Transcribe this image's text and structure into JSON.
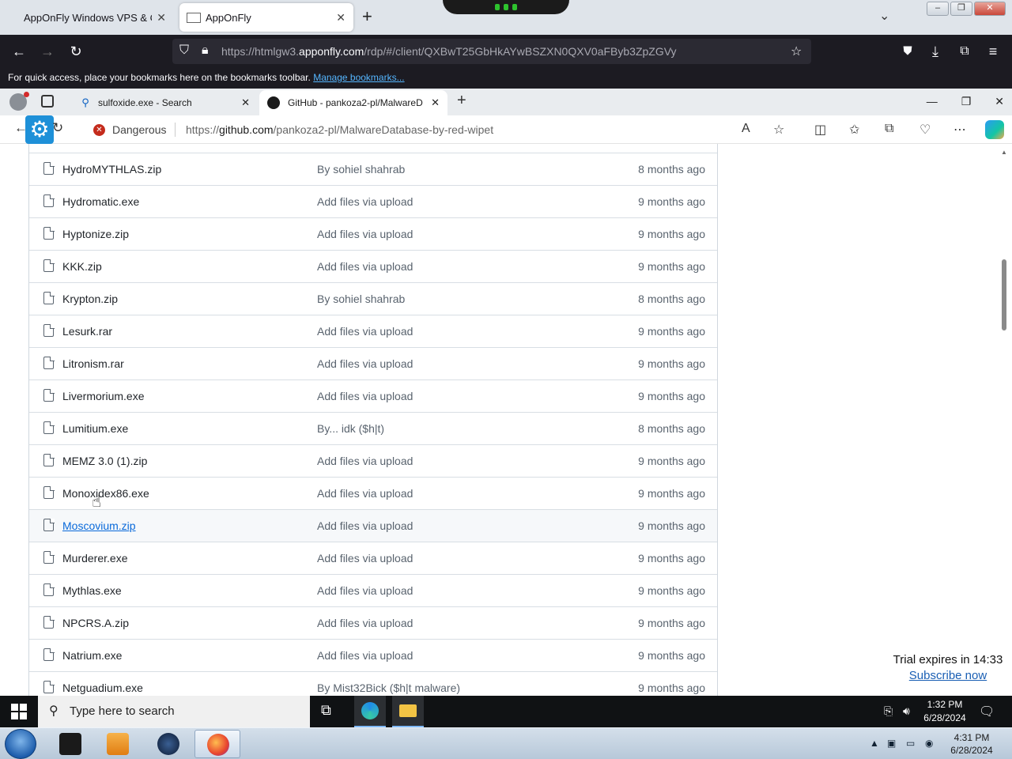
{
  "firefox": {
    "tabs": [
      {
        "label": "AppOnFly Windows VPS & Clo"
      },
      {
        "label": "AppOnFly"
      }
    ],
    "url_prefix": "https://htmlgw3.",
    "url_domain": "apponfly.com",
    "url_rest": "/rdp/#/client/QXBwT25GbHkAYwBSZXN0QXV0aFByb3ZpZGVy",
    "bookmarks_text": "For quick access, place your bookmarks here on the bookmarks toolbar.",
    "bookmarks_link": "Manage bookmarks..."
  },
  "edge": {
    "tabs": [
      {
        "label": "sulfoxide.exe - Search"
      },
      {
        "label": "GitHub - pankoza2-pl/MalwareD"
      }
    ],
    "security_label": "Dangerous",
    "url_prefix": "https://",
    "url_domain": "github.com",
    "url_rest": "/pankoza2-pl/MalwareDatabase-by-red-wipet"
  },
  "files": [
    {
      "name": "HydroMYTHLAS.zip",
      "message": "By sohiel shahrab",
      "age": "8 months ago"
    },
    {
      "name": "Hydromatic.exe",
      "message": "Add files via upload",
      "age": "9 months ago"
    },
    {
      "name": "Hyptonize.zip",
      "message": "Add files via upload",
      "age": "9 months ago"
    },
    {
      "name": "KKK.zip",
      "message": "Add files via upload",
      "age": "9 months ago"
    },
    {
      "name": "Krypton.zip",
      "message": "By sohiel shahrab",
      "age": "8 months ago"
    },
    {
      "name": "Lesurk.rar",
      "message": "Add files via upload",
      "age": "9 months ago"
    },
    {
      "name": "Litronism.rar",
      "message": "Add files via upload",
      "age": "9 months ago"
    },
    {
      "name": "Livermorium.exe",
      "message": "Add files via upload",
      "age": "9 months ago"
    },
    {
      "name": "Lumitium.exe",
      "message": "By... idk ($h|t)",
      "age": "8 months ago"
    },
    {
      "name": "MEMZ 3.0 (1).zip",
      "message": "Add files via upload",
      "age": "9 months ago"
    },
    {
      "name": "Monoxidex86.exe",
      "message": "Add files via upload",
      "age": "9 months ago"
    },
    {
      "name": "Moscovium.zip",
      "message": "Add files via upload",
      "age": "9 months ago"
    },
    {
      "name": "Murderer.exe",
      "message": "Add files via upload",
      "age": "9 months ago"
    },
    {
      "name": "Mythlas.exe",
      "message": "Add files via upload",
      "age": "9 months ago"
    },
    {
      "name": "NPCRS.A.zip",
      "message": "Add files via upload",
      "age": "9 months ago"
    },
    {
      "name": "Natrium.exe",
      "message": "Add files via upload",
      "age": "9 months ago"
    },
    {
      "name": "Netguadium.exe",
      "message": "By Mist32Bick ($h|t malware)",
      "age": "9 months ago"
    }
  ],
  "trial": {
    "text": "Trial expires in 14:33",
    "link": "Subscribe now"
  },
  "taskbar10": {
    "search_placeholder": "Type here to search",
    "time": "1:32 PM",
    "date": "6/28/2024"
  },
  "taskbar7": {
    "time": "4:31 PM",
    "date": "6/28/2024"
  }
}
